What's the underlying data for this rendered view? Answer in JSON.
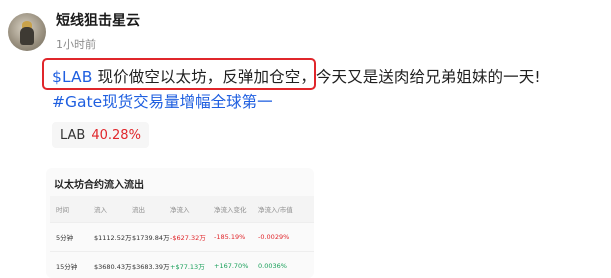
{
  "post": {
    "author": "短线狙击星云",
    "time": "1小时前",
    "cashtag": "$LAB",
    "text_line1": " 现价做空以太坊，反弹加仓空，今天又是送肉给兄弟姐妹的一天!",
    "hashtag": "#Gate现货交易量增幅全球第一"
  },
  "ticker_chip": {
    "symbol": "LAB",
    "change": "40.28%"
  },
  "embedded_card": {
    "title": "以太坊合约流入流出",
    "headers": [
      "时间",
      "流入",
      "流出",
      "净流入",
      "净流入变化",
      "净流入/市值"
    ],
    "rows": [
      [
        "5分钟",
        "$1112.52万",
        "$1739.84万",
        "-$627.32万",
        "-185.19%",
        "-0.0029%"
      ],
      [
        "15分钟",
        "$3680.43万",
        "$3683.39万",
        "+$77.13万",
        "+167.70%",
        "0.0036%"
      ]
    ]
  },
  "colors": {
    "cashtag": "#1f5fe0",
    "highlight_box": "#e0262b",
    "negative": "#e0262b",
    "positive": "#19a05a"
  }
}
